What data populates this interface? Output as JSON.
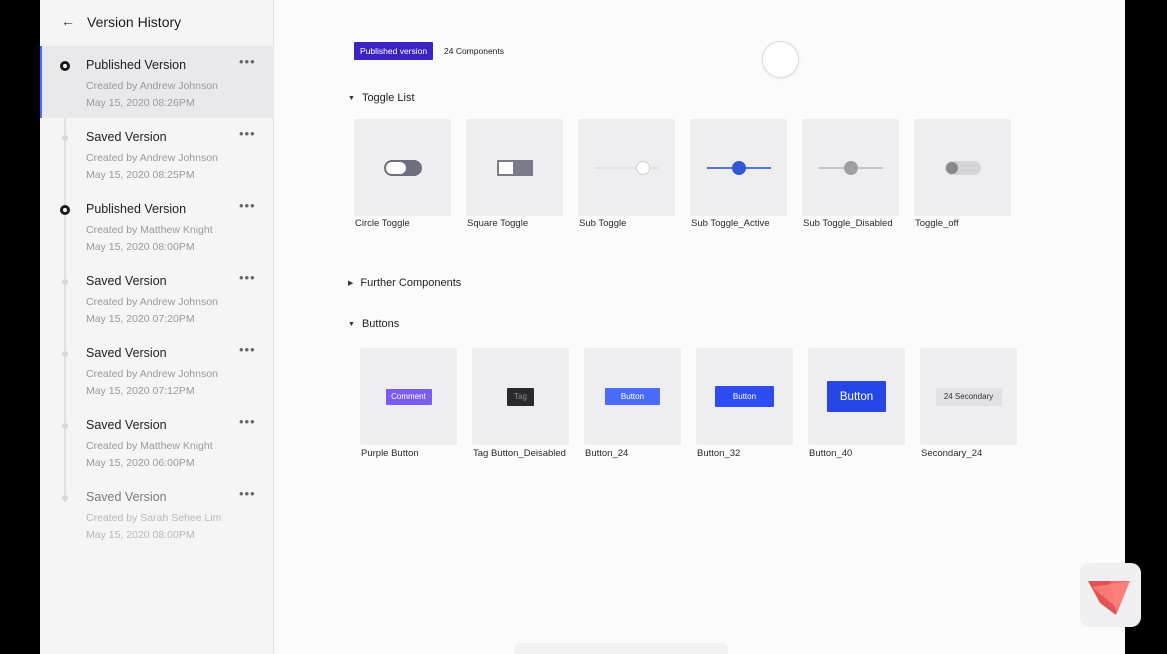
{
  "sidebar": {
    "title": "Version History",
    "versions": [
      {
        "title": "Published Version",
        "author": "Created by Andrew Johnson",
        "time": "May 15, 2020 08:26PM",
        "published": true,
        "active": true
      },
      {
        "title": "Saved Version",
        "author": "Created by Andrew Johnson",
        "time": "May 15, 2020 08:25PM",
        "published": false
      },
      {
        "title": "Published Version",
        "author": "Created by Matthew Knight",
        "time": "May 15, 2020 08:00PM",
        "published": true
      },
      {
        "title": "Saved Version",
        "author": "Created by Andrew Johnson",
        "time": "May 15, 2020 07:20PM",
        "published": false
      },
      {
        "title": "Saved Version",
        "author": "Created by Andrew Johnson",
        "time": "May 15, 2020 07:12PM",
        "published": false
      },
      {
        "title": "Saved Version",
        "author": "Created by Matthew Knight",
        "time": "May 15, 2020 06:00PM",
        "published": false
      },
      {
        "title": "Saved Version",
        "author": "Created by Sarah Sehee Lim",
        "time": "May 15, 2020 08:00PM",
        "published": false,
        "faded": true
      }
    ],
    "more_label": "•••",
    "back_icon": "←"
  },
  "main": {
    "badge": "Published version",
    "component_count": "24 Components",
    "sections": {
      "toggle_list": "Toggle List",
      "further_components": "Further Components",
      "buttons": "Buttons"
    },
    "toggles": [
      {
        "label": "Circle Toggle",
        "kind": "circle"
      },
      {
        "label": "Square Toggle",
        "kind": "square"
      },
      {
        "label": "Sub Toggle",
        "kind": "sub"
      },
      {
        "label": "Sub Toggle_Active",
        "kind": "sub-active"
      },
      {
        "label": "Sub Toggle_Disabled",
        "kind": "sub-disabled"
      },
      {
        "label": "Toggle_off",
        "kind": "off"
      }
    ],
    "buttons": [
      {
        "label": "Purple Button",
        "text": "Comment",
        "color": "#7a5cf0",
        "size": "small"
      },
      {
        "label": "Tag Button_Deisabled",
        "text": "Tag",
        "color": "#2a2a2c",
        "size": "tag"
      },
      {
        "label": "Button_24",
        "text": "Button",
        "color": "#4b6bfb",
        "size": "24"
      },
      {
        "label": "Button_32",
        "text": "Button",
        "color": "#2f4cf0",
        "size": "32"
      },
      {
        "label": "Button_40",
        "text": "Button",
        "color": "#2746e8",
        "size": "40"
      },
      {
        "label": "Secondary_24",
        "text": "24 Secondary",
        "color": "#e1e1e4",
        "size": "secondary"
      }
    ]
  },
  "colors": {
    "accent": "#4b6bfb",
    "badge": "#3a23c2"
  }
}
